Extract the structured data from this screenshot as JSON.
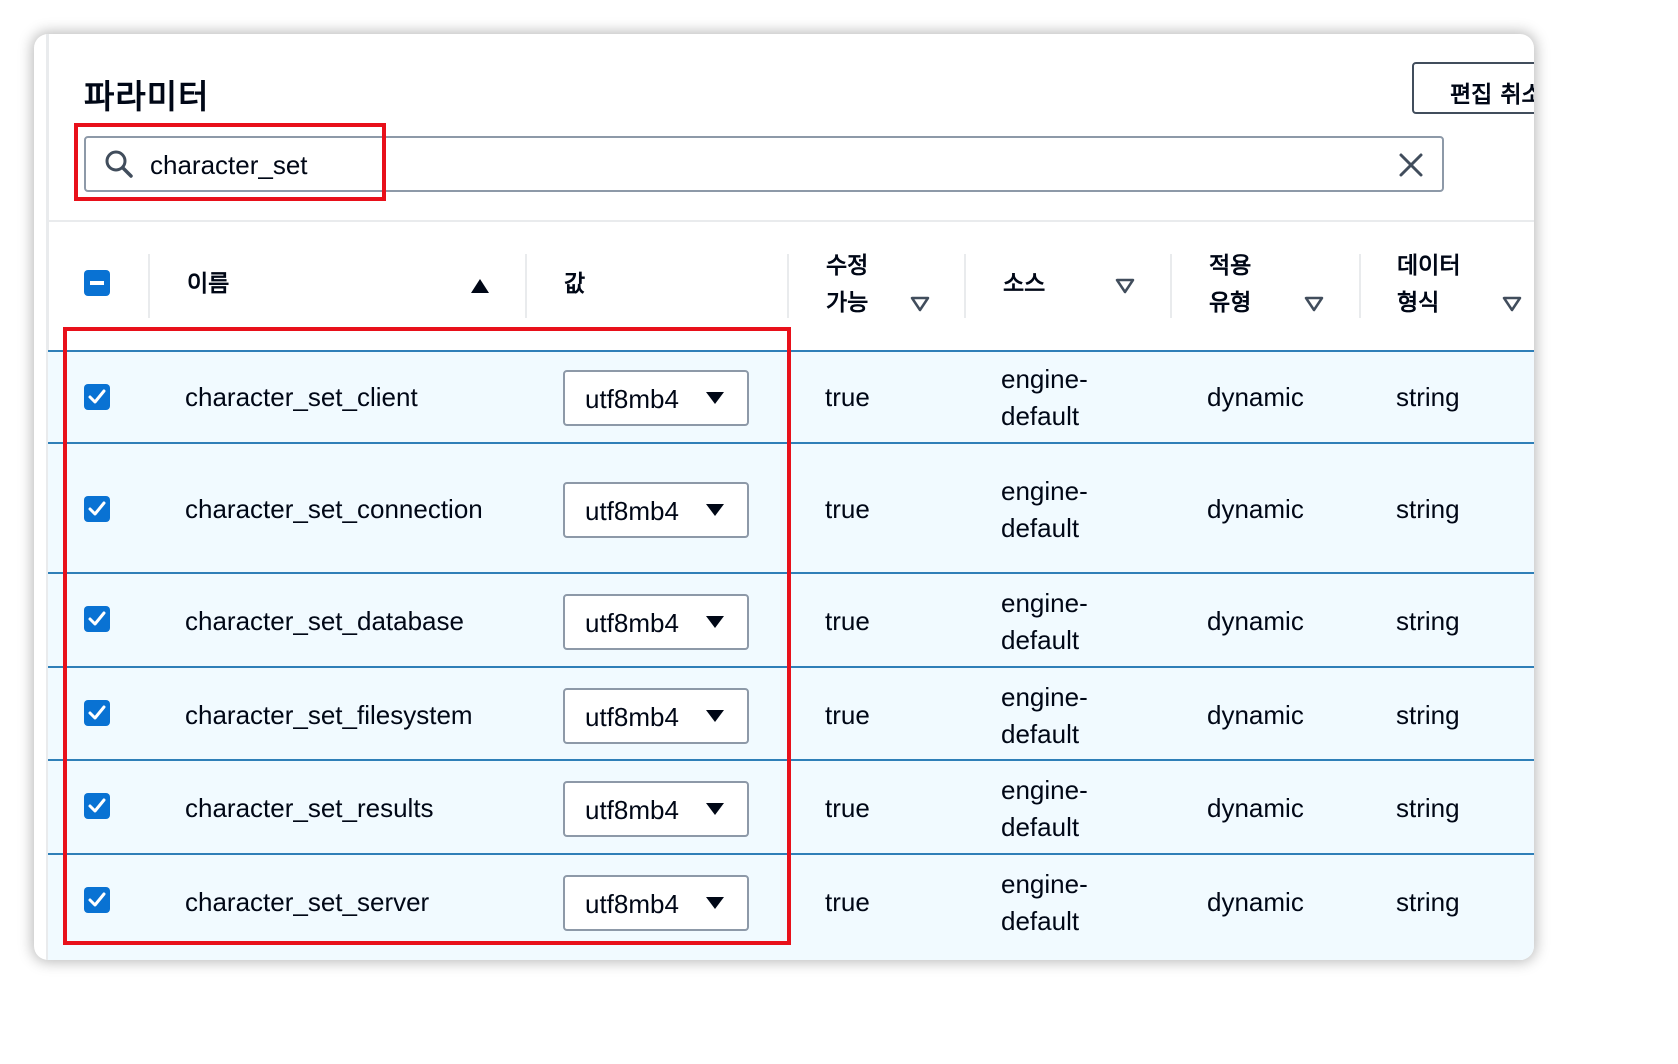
{
  "panel": {
    "title": "파라미터",
    "edit_cancel_label": "편집 취소"
  },
  "search": {
    "value": "character_set",
    "icon": "search-icon",
    "clear_icon": "close-icon"
  },
  "table": {
    "columns": [
      {
        "key": "name",
        "label": "이름",
        "sort": "ascending"
      },
      {
        "key": "value",
        "label": "값"
      },
      {
        "key": "modifiable",
        "label": "수정 가능",
        "filter": true
      },
      {
        "key": "source",
        "label": "소스",
        "filter": true
      },
      {
        "key": "apply_type",
        "label": "적용 유형",
        "filter": true
      },
      {
        "key": "data_type",
        "label": "데이터 형식",
        "filter": true
      }
    ],
    "select_all_state": "indeterminate",
    "rows": [
      {
        "selected": true,
        "name": "character_set_client",
        "value": "utf8mb4",
        "modifiable": "true",
        "source": "engine-default",
        "apply_type": "dynamic",
        "data_type": "string"
      },
      {
        "selected": true,
        "name": "character_set_connection",
        "value": "utf8mb4",
        "modifiable": "true",
        "source": "engine-default",
        "apply_type": "dynamic",
        "data_type": "string"
      },
      {
        "selected": true,
        "name": "character_set_database",
        "value": "utf8mb4",
        "modifiable": "true",
        "source": "engine-default",
        "apply_type": "dynamic",
        "data_type": "string"
      },
      {
        "selected": true,
        "name": "character_set_filesystem",
        "value": "utf8mb4",
        "modifiable": "true",
        "source": "engine-default",
        "apply_type": "dynamic",
        "data_type": "string"
      },
      {
        "selected": true,
        "name": "character_set_results",
        "value": "utf8mb4",
        "modifiable": "true",
        "source": "engine-default",
        "apply_type": "dynamic",
        "data_type": "string"
      },
      {
        "selected": true,
        "name": "character_set_server",
        "value": "utf8mb4",
        "modifiable": "true",
        "source": "engine-default",
        "apply_type": "dynamic",
        "data_type": "string"
      }
    ]
  },
  "colors": {
    "accent": "#0972d3",
    "highlight_annotation": "#e8101a",
    "selected_row_bg": "#f1faff",
    "selected_row_border": "#2f7fb8"
  }
}
